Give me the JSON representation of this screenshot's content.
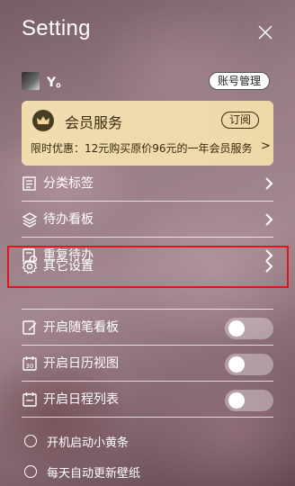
{
  "header": {
    "title": "Setting"
  },
  "user": {
    "name": "Y。",
    "account_button": "账号管理"
  },
  "vip": {
    "title": "会员服务",
    "subscribe_button": "订阅",
    "promo": "限时优惠：12元购买原价96元的一年会员服务",
    "promo_arrow": ">"
  },
  "menu": [
    {
      "label": "分类标签",
      "icon": "list-icon",
      "control": "chevron"
    },
    {
      "label": "待办看板",
      "icon": "layers-icon",
      "control": "chevron"
    },
    {
      "label": "重复待办",
      "icon": "repeat-todo-icon",
      "control": "chevron"
    },
    {
      "label": "其它设置",
      "icon": "gear-icon",
      "control": "chevron",
      "highlighted": true
    }
  ],
  "toggles": [
    {
      "label": "开启随笔看板",
      "icon": "note-edit-icon",
      "on": false
    },
    {
      "label": "开启日历视图",
      "icon": "calendar-icon",
      "on": false
    },
    {
      "label": "开启日程列表",
      "icon": "schedule-list-icon",
      "on": false
    }
  ],
  "options": [
    {
      "label": "开机启动小黄条",
      "checked": false
    },
    {
      "label": "每天自动更新壁纸",
      "checked": false
    }
  ],
  "colors": {
    "vip_card": "#f1dcb0",
    "highlight_border": "#e0141b",
    "text": "#ffffff"
  }
}
